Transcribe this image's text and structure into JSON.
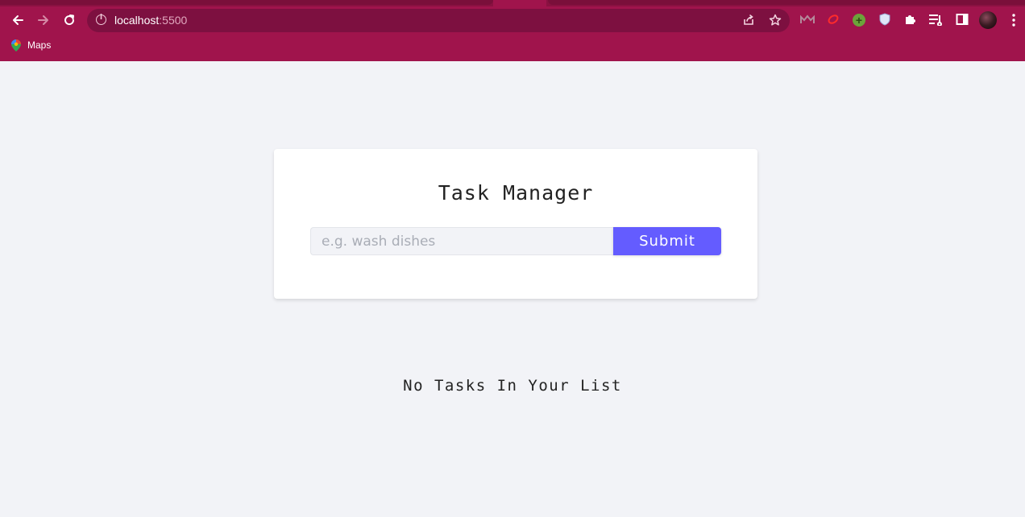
{
  "browser": {
    "url_host": "localhost",
    "url_port": ":5500",
    "bookmarks": [
      {
        "label": "Maps"
      }
    ],
    "icons": {
      "back": "back-arrow-icon",
      "forward": "forward-arrow-icon",
      "reload": "reload-icon",
      "site_info": "info-icon",
      "share": "share-icon",
      "bookmark_star": "star-icon",
      "extensions": "puzzle-icon",
      "reading_list": "reading-list-icon",
      "side_panel": "side-panel-icon",
      "menu": "kebab-menu-icon"
    },
    "colors": {
      "chrome_bg": "#a0144c",
      "omnibox_bg": "#7d1040"
    }
  },
  "app": {
    "title": "Task Manager",
    "input": {
      "value": "",
      "placeholder": "e.g. wash dishes"
    },
    "submit_label": "Submit",
    "empty_message": "No Tasks In Your List",
    "colors": {
      "accent": "#645cff",
      "page_bg": "#f2f3f7",
      "card_bg": "#ffffff"
    }
  }
}
